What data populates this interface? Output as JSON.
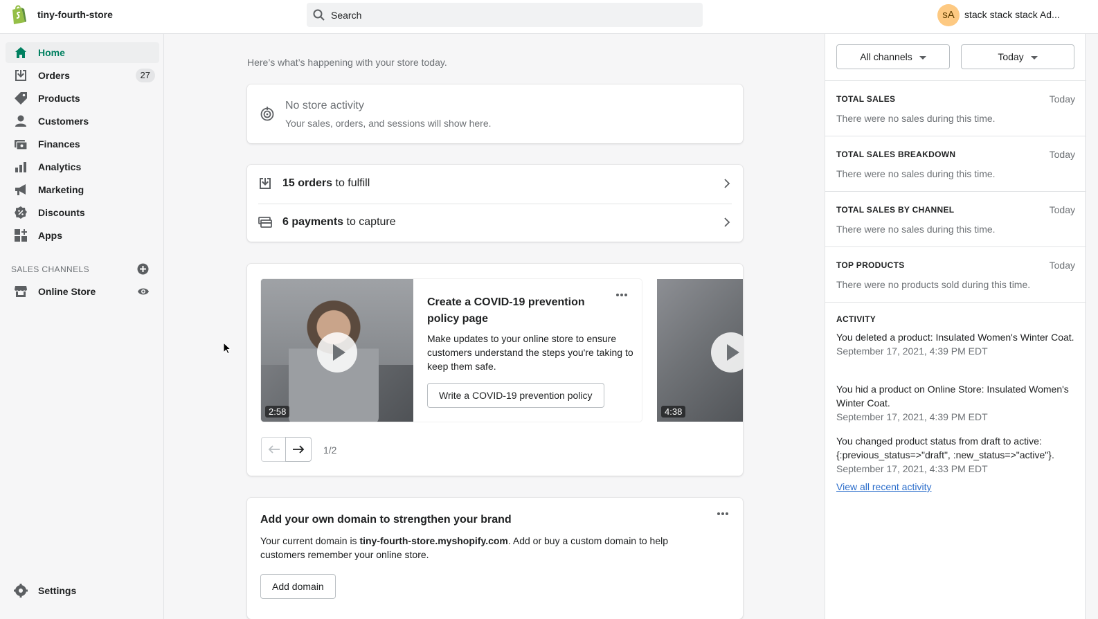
{
  "header": {
    "store_name": "tiny-fourth-store",
    "search_placeholder": "Search",
    "avatar_initials": "sA",
    "user_name": "stack stack stack Ad..."
  },
  "sidebar": {
    "items": [
      {
        "label": "Home",
        "icon": "home-icon",
        "active": true
      },
      {
        "label": "Orders",
        "icon": "orders-icon",
        "badge": "27"
      },
      {
        "label": "Products",
        "icon": "tag-icon"
      },
      {
        "label": "Customers",
        "icon": "person-icon"
      },
      {
        "label": "Finances",
        "icon": "finances-icon"
      },
      {
        "label": "Analytics",
        "icon": "bar-chart-icon"
      },
      {
        "label": "Marketing",
        "icon": "megaphone-icon"
      },
      {
        "label": "Discounts",
        "icon": "discount-icon"
      },
      {
        "label": "Apps",
        "icon": "apps-icon"
      }
    ],
    "sales_channels_title": "SALES CHANNELS",
    "online_store": "Online Store",
    "settings": "Settings"
  },
  "main": {
    "subtitle": "Here’s what’s happening with your store today.",
    "activity": {
      "title": "No store activity",
      "description": "Your sales, orders, and sessions will show here."
    },
    "tasks": [
      {
        "bold": "15 orders",
        "rest": " to fulfill"
      },
      {
        "bold": "6 payments",
        "rest": " to capture"
      }
    ],
    "carousel": {
      "slide_title": "Create a COVID-19 prevention policy page",
      "slide_description": "Make updates to your online store to ensure customers understand the steps you're taking to keep them safe.",
      "slide_button": "Write a COVID-19 prevention policy",
      "duration_1": "2:58",
      "duration_2": "4:38",
      "page_count": "1/2"
    },
    "domain": {
      "title": "Add your own domain to strengthen your brand",
      "desc_prefix": "Your current domain is ",
      "desc_domain": "tiny-fourth-store.myshopify.com",
      "desc_suffix": ". Add or buy a custom domain to help customers remember your online store.",
      "button": "Add domain"
    }
  },
  "right_panel": {
    "channels_button": "All channels",
    "date_button": "Today",
    "sections": [
      {
        "heading": "TOTAL SALES",
        "period": "Today",
        "text": "There were no sales during this time."
      },
      {
        "heading": "TOTAL SALES BREAKDOWN",
        "period": "Today",
        "text": "There were no sales during this time."
      },
      {
        "heading": "TOTAL SALES BY CHANNEL",
        "period": "Today",
        "text": "There were no sales during this time."
      },
      {
        "heading": "TOP PRODUCTS",
        "period": "Today",
        "text": "There were no products sold during this time."
      }
    ],
    "activity_heading": "ACTIVITY",
    "activity": [
      {
        "text": "You deleted a product: Insulated Women's Winter Coat.",
        "date": "September 17, 2021, 4:39 PM EDT"
      },
      {
        "text": "You hid a product on Online Store: Insulated Women's Winter Coat.",
        "date": "September 17, 2021, 4:39 PM EDT"
      },
      {
        "text": "You changed product status from draft to active: {:previous_status=>\"draft\", :new_status=>\"active\"}.",
        "date": "September 17, 2021, 4:33 PM EDT"
      }
    ],
    "view_all": "View all recent activity"
  },
  "colors": {
    "accent_green": "#008060",
    "link_blue": "#2c6ecb",
    "avatar_bg": "#fdc982"
  }
}
